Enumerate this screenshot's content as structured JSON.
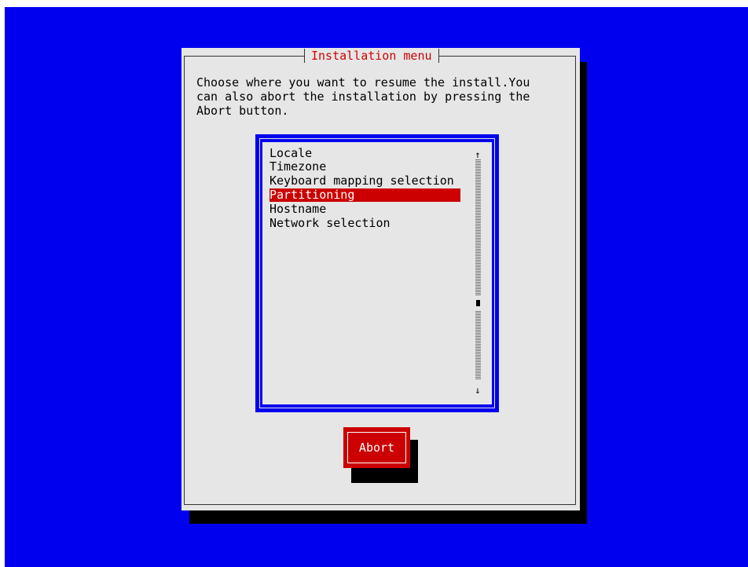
{
  "dialog": {
    "title": "Installation menu",
    "message": "Choose where you want to resume the install.You\ncan also abort the installation by pressing the\nAbort button."
  },
  "menu": {
    "items": [
      "Locale",
      "Timezone",
      "Keyboard mapping selection",
      "Partitioning",
      "Hostname",
      "Network selection"
    ],
    "selected_index": 3,
    "scroll_up_arrow": "↑",
    "scroll_down_arrow": "↓"
  },
  "buttons": {
    "abort_label": "Abort"
  },
  "colors": {
    "background": "#0000ee",
    "dialog": "#e6e6e6",
    "accent": "#cc0000",
    "title_text": "#cc0000"
  }
}
